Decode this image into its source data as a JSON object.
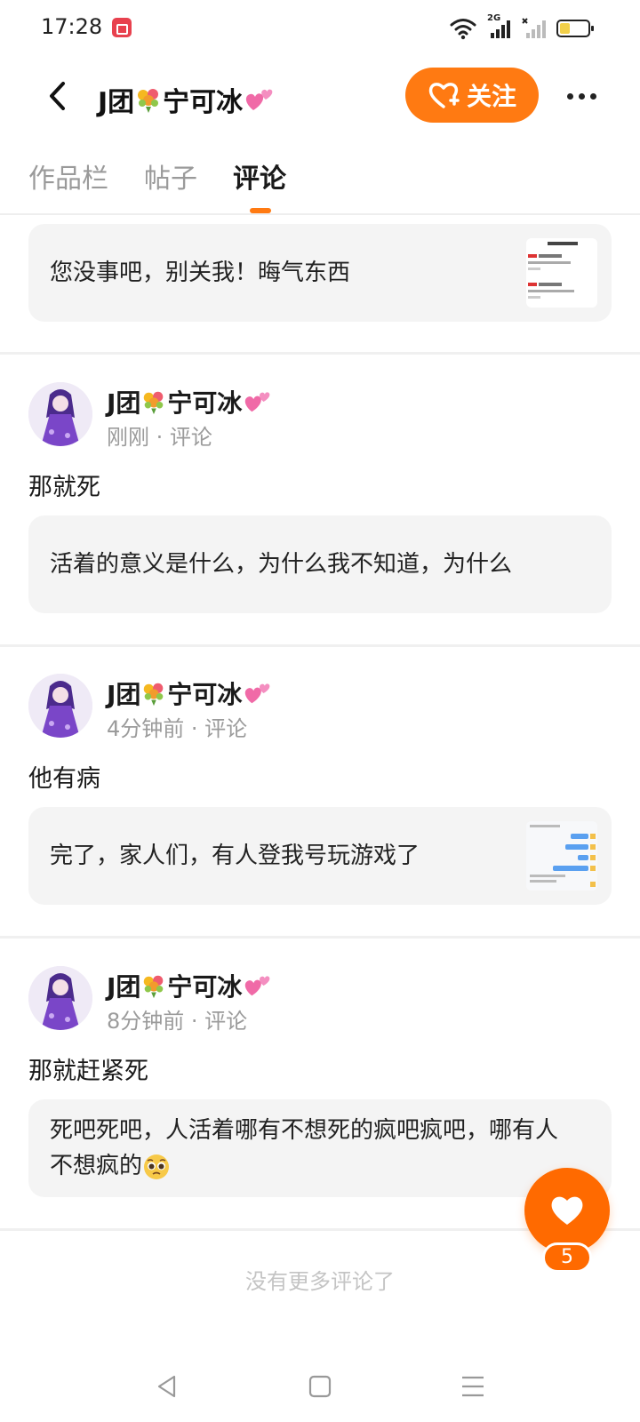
{
  "status_bar": {
    "time": "17:28",
    "network_label": "2G",
    "battery_level": 0.35,
    "icons": [
      "screen-record-icon",
      "wifi-icon",
      "signal-icon",
      "battery-icon"
    ]
  },
  "header": {
    "title_prefix": "J团",
    "title_name": "宁可冰",
    "follow_label": "关注",
    "accent_color": "#ff7a12"
  },
  "tabs": [
    {
      "label": "作品栏",
      "active": false
    },
    {
      "label": "帖子",
      "active": false
    },
    {
      "label": "评论",
      "active": true
    }
  ],
  "top_quote": {
    "text": "您没事吧，别关我！晦气东西"
  },
  "comments": [
    {
      "author_prefix": "J团",
      "author_name": "宁可冰",
      "meta": "刚刚 · 评论",
      "text": "那就死",
      "quote": "活着的意义是什么，为什么我不知道，为什么"
    },
    {
      "author_prefix": "J团",
      "author_name": "宁可冰",
      "meta": "4分钟前 · 评论",
      "text": "他有病",
      "quote": "完了，家人们，有人登我号玩游戏了"
    },
    {
      "author_prefix": "J团",
      "author_name": "宁可冰",
      "meta": "8分钟前 · 评论",
      "text": "那就赶紧死",
      "quote": "死吧死吧，人活着哪有不想死的疯吧疯吧，哪有人不想疯的"
    }
  ],
  "footer": {
    "no_more": "没有更多评论了"
  },
  "like": {
    "count": "5"
  }
}
